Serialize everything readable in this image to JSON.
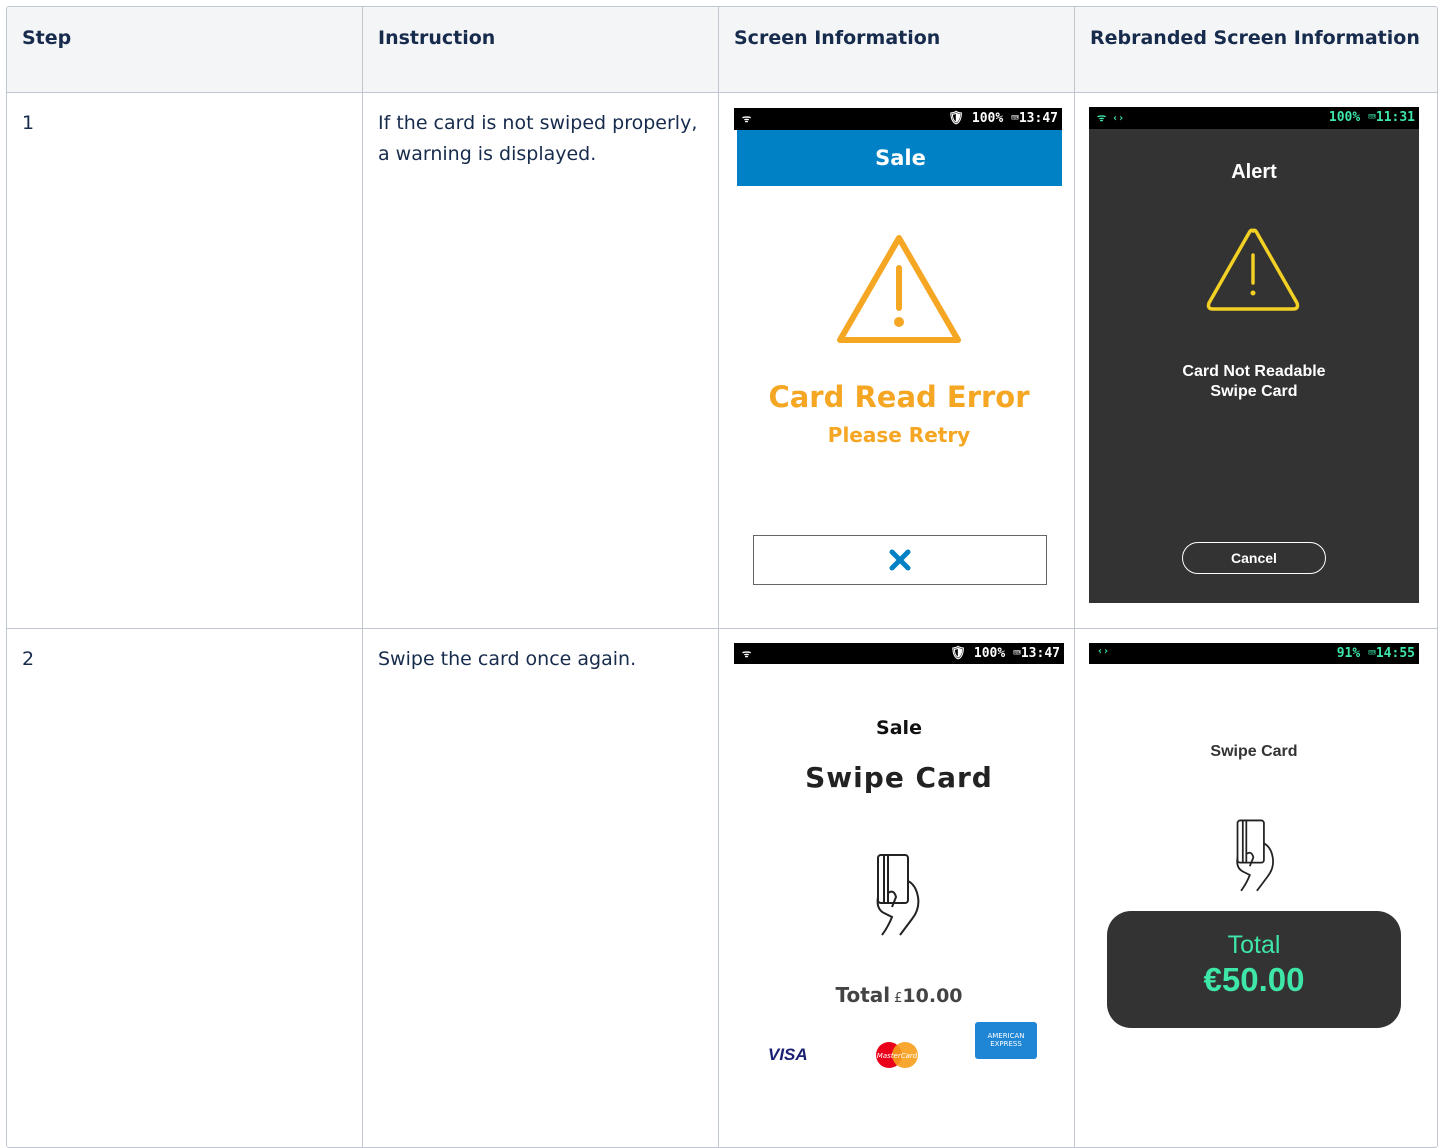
{
  "table": {
    "headers": [
      "Step",
      "Instruction",
      "Screen Information",
      "Rebranded Screen Information"
    ],
    "rows": [
      {
        "step": "1",
        "instruction": "If the card is not swiped properly, a warning is displayed."
      },
      {
        "step": "2",
        "instruction": "Swipe the card once again."
      }
    ]
  },
  "screens": {
    "s1": {
      "status": {
        "left": "ᯤ",
        "right": "🛡 100% ⌨13:47"
      },
      "banner": "Sale",
      "error_title": "Card Read Error",
      "error_sub": "Please Retry",
      "cancel_icon": "close-icon",
      "accent": "#0081c6",
      "warn": "#f5a623"
    },
    "s2": {
      "status": {
        "left": "ᯤ ‹›",
        "right": "100% ⌨11:31"
      },
      "title": "Alert",
      "message_1": "Card Not Readable",
      "message_2": "Swipe Card",
      "cancel_label": "Cancel",
      "bg": "#333333",
      "warn": "#f2d024"
    },
    "s3": {
      "status": {
        "left": "ᯤ",
        "right": "🛡 100% ⌨13:47"
      },
      "sale": "Sale",
      "prompt": "Swipe Card",
      "total_label": "Total",
      "currency": "£",
      "amount": "10.00",
      "visa": "VISA",
      "mastercard": "MasterCard",
      "amex_1": "AMERICAN",
      "amex_2": "EXPRESS"
    },
    "s4": {
      "status": {
        "left": "‹›",
        "right": "91% ⌨14:55"
      },
      "prompt": "Swipe Card",
      "total_label": "Total",
      "amount": "€50.00",
      "accent": "#3ee6a8"
    }
  }
}
